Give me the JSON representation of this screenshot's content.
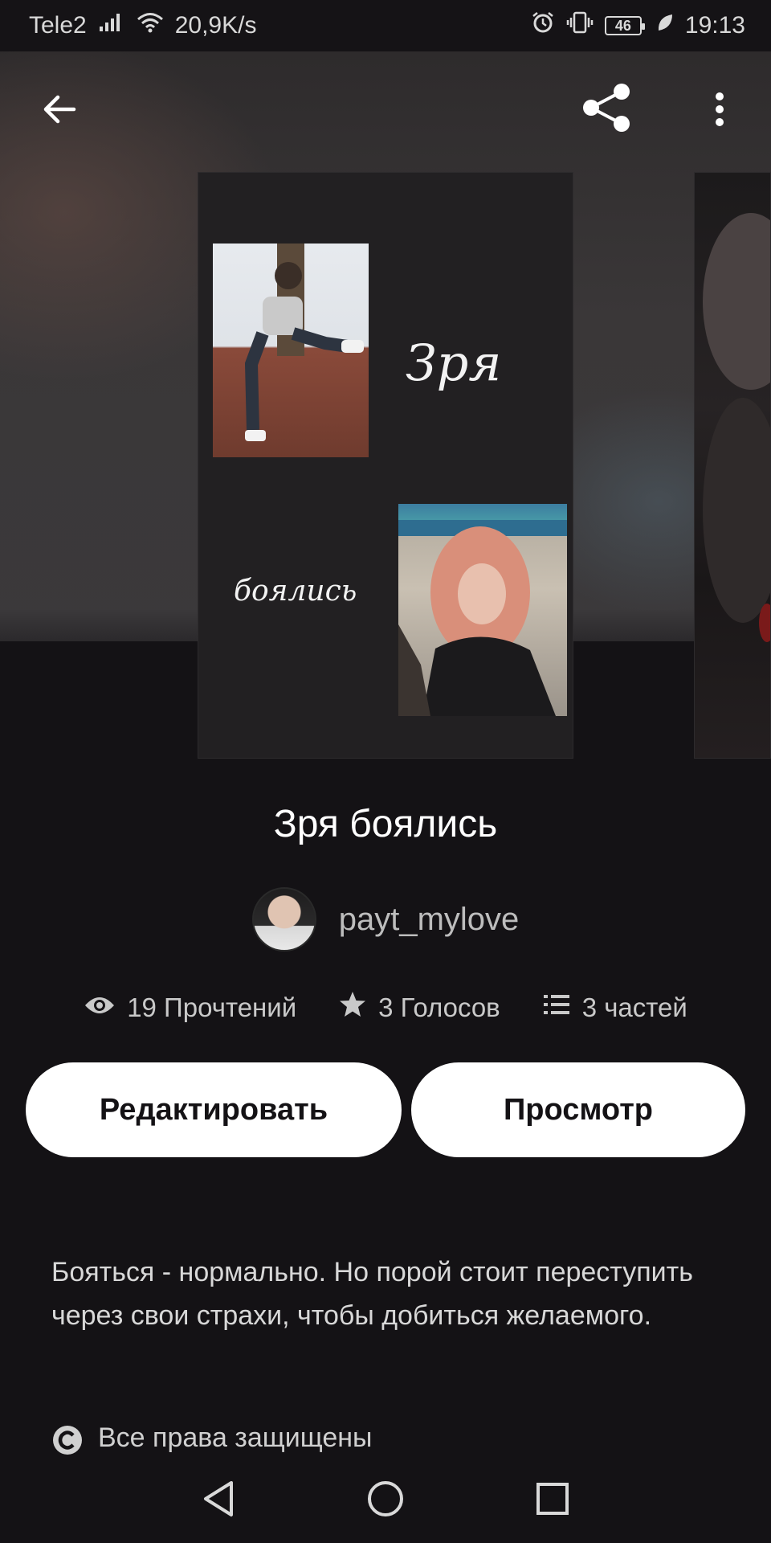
{
  "status_bar": {
    "carrier": "Tele2",
    "network_speed": "20,9K/s",
    "battery": "46",
    "time": "19:13",
    "icons": [
      "signal-icon",
      "wifi-icon",
      "alarm-icon",
      "vibrate-icon",
      "battery-icon",
      "leaf-icon"
    ]
  },
  "toolbar": {
    "back_icon": "arrow-left-icon",
    "share_icon": "share-icon",
    "menu_icon": "more-vertical-icon"
  },
  "cover": {
    "script_line_1": "Зря",
    "script_line_2": "боялись"
  },
  "story": {
    "title": "Зря боялись",
    "author": "payt_mylove",
    "stats": {
      "reads": "19 Прочтений",
      "votes": "3 Голосов",
      "parts": "3 частей"
    },
    "description": "Бояться - нормально. Но порой стоит переступить через свои страхи, чтобы добиться желаемого.",
    "rights": "Все права защищены"
  },
  "buttons": {
    "edit_label": "Редактировать",
    "view_label": "Просмотр"
  },
  "colors": {
    "background": "#141215",
    "button_bg": "#ffffff",
    "button_text": "#141215",
    "muted_text": "#bdbdbd"
  }
}
